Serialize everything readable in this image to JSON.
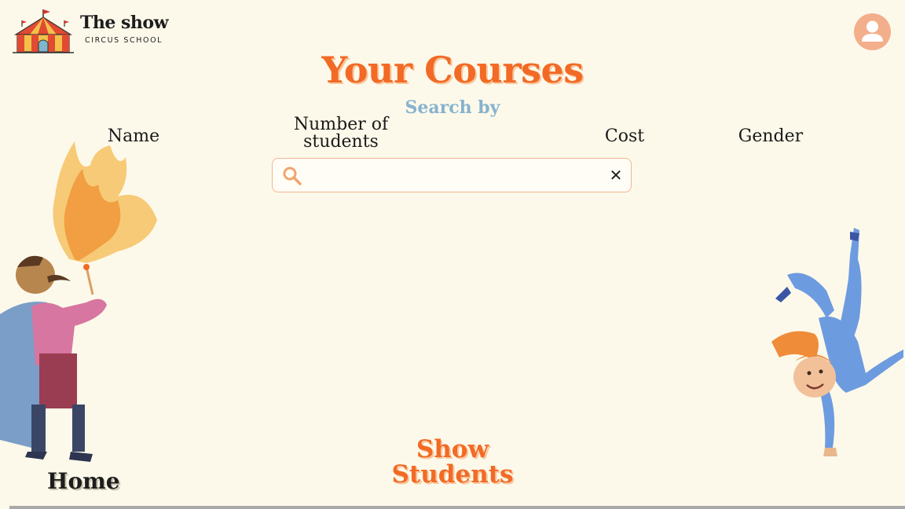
{
  "header": {
    "brand_name": "The show",
    "brand_subtitle": "CIRCUS SCHOOL",
    "logo_icon": "circus-tent-icon",
    "profile_icon": "user-avatar-icon"
  },
  "main": {
    "title": "Your Courses",
    "search_by_label": "Search by",
    "filters": [
      "Name",
      "Number of students",
      "Cost",
      "Gender"
    ],
    "search": {
      "value": "",
      "placeholder": "",
      "search_icon": "search-icon",
      "clear_icon": "close-icon",
      "clear_glyph": "✕"
    }
  },
  "footer": {
    "home_label": "Home",
    "show_students_label": "Show Students"
  },
  "colors": {
    "background": "#fdf9ea",
    "accent": "#f26a25",
    "search_by": "#86b3cf",
    "avatar": "#f3ae8b"
  }
}
